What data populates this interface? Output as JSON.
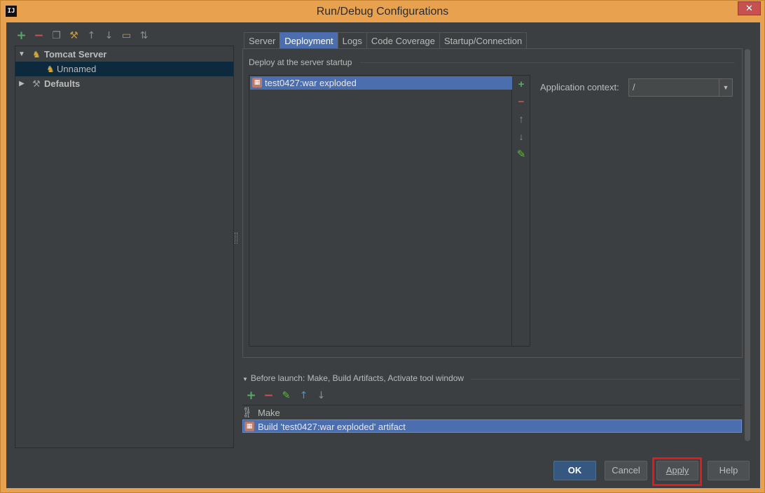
{
  "window": {
    "app_icon_label": "IJ",
    "title": "Run/Debug Configurations",
    "close_label": "✕"
  },
  "left_toolbar": {
    "icons": [
      "add-icon",
      "remove-icon",
      "copy-icon",
      "edit-defaults-icon",
      "move-up-icon",
      "move-down-icon",
      "folder-icon",
      "sort-icon"
    ]
  },
  "tree": {
    "items": [
      {
        "label": "Tomcat Server",
        "expanded": true,
        "icon": "tomcat-icon"
      },
      {
        "label": "Unnamed",
        "selected": true,
        "icon": "tomcat-icon"
      },
      {
        "label": "Defaults",
        "expanded": false,
        "icon": "wrench-icon"
      }
    ]
  },
  "tabs": [
    {
      "label": "Server"
    },
    {
      "label": "Deployment",
      "active": true
    },
    {
      "label": "Logs"
    },
    {
      "label": "Code Coverage"
    },
    {
      "label": "Startup/Connection"
    }
  ],
  "deployment": {
    "section_title": "Deploy at the server startup",
    "items": [
      {
        "label": "test0427:war exploded",
        "selected": true,
        "icon": "artifact-icon"
      }
    ],
    "side_buttons": [
      "add-icon",
      "remove-icon",
      "move-up-icon",
      "move-down-icon",
      "edit-icon"
    ],
    "application_context_label": "Application context:",
    "application_context_value": "/"
  },
  "before_launch": {
    "header": "Before launch: Make, Build Artifacts, Activate tool window",
    "toolbar_icons": [
      "add-icon",
      "remove-icon",
      "edit-icon",
      "move-up-icon",
      "move-down-icon"
    ],
    "items": [
      {
        "label": "Make",
        "icon": "make-icon"
      },
      {
        "label": "Build 'test0427:war exploded' artifact",
        "icon": "artifact-icon",
        "selected": true
      }
    ]
  },
  "buttons": {
    "ok": "OK",
    "cancel": "Cancel",
    "apply": "Apply",
    "help": "Help"
  },
  "colors": {
    "frame": "#e8a24f",
    "background": "#3c3f41",
    "selection": "#4b6eaf",
    "highlight_box": "#e01b1b"
  }
}
